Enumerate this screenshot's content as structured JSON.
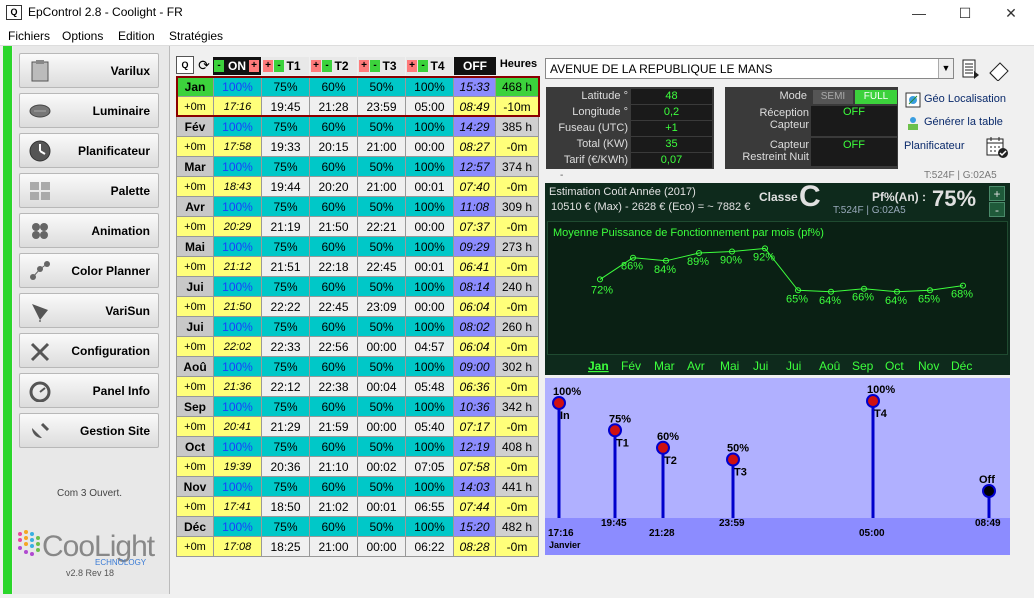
{
  "window": {
    "title": "EpControl  2.8  -  Coolight - FR",
    "minimize": "—",
    "maximize": "☐",
    "close": "✕"
  },
  "menu": [
    "Fichiers",
    "Options",
    "Edition",
    "Stratégies"
  ],
  "nav": [
    {
      "label": "Varilux",
      "icon": "clipboard-icon"
    },
    {
      "label": "Luminaire",
      "icon": "luminaire-icon"
    },
    {
      "label": "Planificateur",
      "icon": "clock-icon"
    },
    {
      "label": "Palette",
      "icon": "palette-icon"
    },
    {
      "label": "Animation",
      "icon": "animation-icon"
    },
    {
      "label": "Color Planner",
      "icon": "color-planner-icon"
    },
    {
      "label": "VariSun",
      "icon": "solar-panel-icon"
    },
    {
      "label": "Configuration",
      "icon": "tools-icon"
    },
    {
      "label": "Panel Info",
      "icon": "dashboard-icon"
    },
    {
      "label": "Gestion Site",
      "icon": "satellite-icon"
    }
  ],
  "com_status": "Com 3 Ouvert.",
  "logo": {
    "text": "CooLight",
    "sub": "ECHNOLOGY"
  },
  "version": "v2.8 Rev 18",
  "sched_header": {
    "on": "ON",
    "t1": "T1",
    "t2": "T2",
    "t3": "T3",
    "t4": "T4",
    "off": "OFF",
    "heures": "Heures",
    "minus": "-",
    "plus": "+"
  },
  "months": [
    {
      "m": "Jan",
      "on": "100%",
      "t1": "75%",
      "t2": "60%",
      "t3": "50%",
      "t4": "100%",
      "off": "15:33",
      "h": "468 h",
      "d": "+0m",
      "on_t": "17:16",
      "t1_t": "19:45",
      "t2_t": "21:28",
      "t3_t": "23:59",
      "t4_t": "05:00",
      "off_t": "08:49",
      "dh": "-10m"
    },
    {
      "m": "Fév",
      "on": "100%",
      "t1": "75%",
      "t2": "60%",
      "t3": "50%",
      "t4": "100%",
      "off": "14:29",
      "h": "385 h",
      "d": "+0m",
      "on_t": "17:58",
      "t1_t": "19:33",
      "t2_t": "20:15",
      "t3_t": "21:00",
      "t4_t": "00:00",
      "off_t": "08:27",
      "dh": "-0m"
    },
    {
      "m": "Mar",
      "on": "100%",
      "t1": "75%",
      "t2": "60%",
      "t3": "50%",
      "t4": "100%",
      "off": "12:57",
      "h": "374 h",
      "d": "+0m",
      "on_t": "18:43",
      "t1_t": "19:44",
      "t2_t": "20:20",
      "t3_t": "21:00",
      "t4_t": "00:01",
      "off_t": "07:40",
      "dh": "-0m"
    },
    {
      "m": "Avr",
      "on": "100%",
      "t1": "75%",
      "t2": "60%",
      "t3": "50%",
      "t4": "100%",
      "off": "11:08",
      "h": "309 h",
      "d": "+0m",
      "on_t": "20:29",
      "t1_t": "21:19",
      "t2_t": "21:50",
      "t3_t": "22:21",
      "t4_t": "00:00",
      "off_t": "07:37",
      "dh": "-0m"
    },
    {
      "m": "Mai",
      "on": "100%",
      "t1": "75%",
      "t2": "60%",
      "t3": "50%",
      "t4": "100%",
      "off": "09:29",
      "h": "273 h",
      "d": "+0m",
      "on_t": "21:12",
      "t1_t": "21:51",
      "t2_t": "22:18",
      "t3_t": "22:45",
      "t4_t": "00:01",
      "off_t": "06:41",
      "dh": "-0m"
    },
    {
      "m": "Jui",
      "on": "100%",
      "t1": "75%",
      "t2": "60%",
      "t3": "50%",
      "t4": "100%",
      "off": "08:14",
      "h": "240 h",
      "d": "+0m",
      "on_t": "21:50",
      "t1_t": "22:22",
      "t2_t": "22:45",
      "t3_t": "23:09",
      "t4_t": "00:00",
      "off_t": "06:04",
      "dh": "-0m"
    },
    {
      "m": "Jui",
      "on": "100%",
      "t1": "75%",
      "t2": "60%",
      "t3": "50%",
      "t4": "100%",
      "off": "08:02",
      "h": "260 h",
      "d": "+0m",
      "on_t": "22:02",
      "t1_t": "22:33",
      "t2_t": "22:56",
      "t3_t": "00:00",
      "t4_t": "04:57",
      "off_t": "06:04",
      "dh": "-0m"
    },
    {
      "m": "Aoû",
      "on": "100%",
      "t1": "75%",
      "t2": "60%",
      "t3": "50%",
      "t4": "100%",
      "off": "09:00",
      "h": "302 h",
      "d": "+0m",
      "on_t": "21:36",
      "t1_t": "22:12",
      "t2_t": "22:38",
      "t3_t": "00:04",
      "t4_t": "05:48",
      "off_t": "06:36",
      "dh": "-0m"
    },
    {
      "m": "Sep",
      "on": "100%",
      "t1": "75%",
      "t2": "60%",
      "t3": "50%",
      "t4": "100%",
      "off": "10:36",
      "h": "342 h",
      "d": "+0m",
      "on_t": "20:41",
      "t1_t": "21:29",
      "t2_t": "21:59",
      "t3_t": "00:00",
      "t4_t": "05:40",
      "off_t": "07:17",
      "dh": "-0m"
    },
    {
      "m": "Oct",
      "on": "100%",
      "t1": "75%",
      "t2": "60%",
      "t3": "50%",
      "t4": "100%",
      "off": "12:19",
      "h": "408 h",
      "d": "+0m",
      "on_t": "19:39",
      "t1_t": "20:36",
      "t2_t": "21:10",
      "t3_t": "00:02",
      "t4_t": "07:05",
      "off_t": "07:58",
      "dh": "-0m"
    },
    {
      "m": "Nov",
      "on": "100%",
      "t1": "75%",
      "t2": "60%",
      "t3": "50%",
      "t4": "100%",
      "off": "14:03",
      "h": "441 h",
      "d": "+0m",
      "on_t": "17:41",
      "t1_t": "18:50",
      "t2_t": "21:02",
      "t3_t": "00:01",
      "t4_t": "06:55",
      "off_t": "07:44",
      "dh": "-0m"
    },
    {
      "m": "Déc",
      "on": "100%",
      "t1": "75%",
      "t2": "60%",
      "t3": "50%",
      "t4": "100%",
      "off": "15:20",
      "h": "482 h",
      "d": "+0m",
      "on_t": "17:08",
      "t1_t": "18:25",
      "t2_t": "21:00",
      "t3_t": "00:00",
      "t4_t": "06:22",
      "off_t": "08:28",
      "dh": "-0m"
    }
  ],
  "address": "AVENUE DE LA REPUBLIQUE LE MANS",
  "geo": [
    {
      "label": "Latitude °",
      "value": "48"
    },
    {
      "label": "Longitude °",
      "value": "0,2"
    },
    {
      "label": "Fuseau (UTC)",
      "value": "+1"
    },
    {
      "label": "Total (KW)",
      "value": "35"
    },
    {
      "label": "Tarif (€/KWh)",
      "value": "0,07"
    }
  ],
  "mode": {
    "label": "Mode",
    "semi": "SEMI",
    "full": "FULL",
    "reception_label": "Réception Capteur",
    "reception": "OFF",
    "capteur_label": "Capteur Restreint Nuit",
    "capteur": "OFF"
  },
  "right_links": {
    "geo": "Géo Localisation",
    "table": "Générer la table",
    "planif": "Planificateur"
  },
  "code": "T:524F | G:02A5",
  "dash": "-",
  "chart1": {
    "est_title": "Estimation Coût Année (2017)",
    "est_line": "10510 € (Max) - 2628 € (Eco) = ~ 7882 €",
    "classe_label": "Classe :",
    "classe": "C",
    "pf_label": "Pf%(An) :",
    "pf": "75%",
    "code": "T:524F | G:02A5",
    "plus": "+",
    "minus": "-",
    "subtitle": "Moyenne Puissance de Fonctionnement par mois (pf%)"
  },
  "chart_data": [
    {
      "type": "line",
      "title": "Moyenne Puissance de Fonctionnement par mois (pf%)",
      "categories": [
        "Jan",
        "Fév",
        "Mar",
        "Avr",
        "Mai",
        "Jui",
        "Jui",
        "Aoû",
        "Sep",
        "Oct",
        "Nov",
        "Déc"
      ],
      "values": [
        72,
        86,
        84,
        89,
        90,
        92,
        65,
        64,
        66,
        64,
        65,
        68
      ],
      "labels": [
        "72%",
        "86%",
        "84%",
        "89%",
        "90%",
        "92%",
        "65%",
        "64%",
        "66%",
        "64%",
        "65%",
        "68%"
      ],
      "selected": "Jan",
      "color": "#3dff3d"
    },
    {
      "type": "scatter",
      "title": "",
      "points": [
        {
          "name": "In",
          "pct": 100,
          "pct_label": "100%",
          "time": "17:16"
        },
        {
          "name": "T1",
          "pct": 75,
          "pct_label": "75%",
          "time": "19:45"
        },
        {
          "name": "T2",
          "pct": 60,
          "pct_label": "60%",
          "time": "21:28"
        },
        {
          "name": "T3",
          "pct": 50,
          "pct_label": "50%",
          "time": "23:59"
        },
        {
          "name": "T4",
          "pct": 100,
          "pct_label": "100%",
          "time": "05:00"
        },
        {
          "name": "Off",
          "pct": 0,
          "pct_label": "",
          "time": "08:49"
        }
      ],
      "month_label": "Janvier"
    }
  ]
}
